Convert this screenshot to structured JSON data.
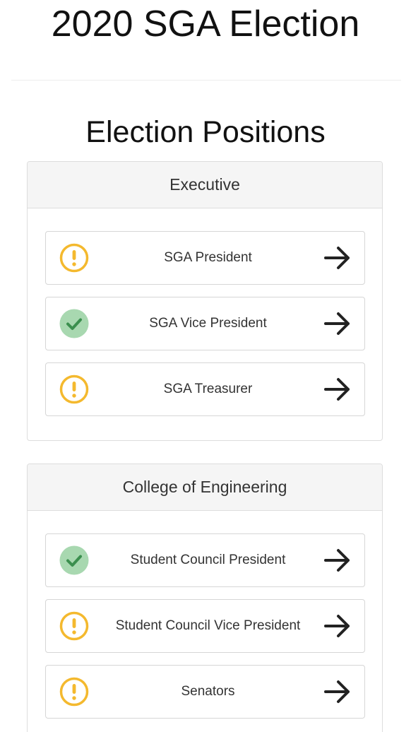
{
  "page": {
    "title": "2020 SGA Election",
    "section_heading": "Election Positions"
  },
  "colors": {
    "pending": "#f4b92e",
    "complete_bg": "#a8d8b0",
    "complete_check": "#3b8f4e"
  },
  "groups": [
    {
      "name": "Executive",
      "positions": [
        {
          "label": "SGA President",
          "status": "pending",
          "status_icon": "exclamation-circle-icon",
          "action_icon": "arrow-right-icon"
        },
        {
          "label": "SGA Vice President",
          "status": "complete",
          "status_icon": "check-circle-icon",
          "action_icon": "arrow-right-icon"
        },
        {
          "label": "SGA Treasurer",
          "status": "pending",
          "status_icon": "exclamation-circle-icon",
          "action_icon": "arrow-right-icon"
        }
      ]
    },
    {
      "name": "College of Engineering",
      "positions": [
        {
          "label": "Student Council President",
          "status": "complete",
          "status_icon": "check-circle-icon",
          "action_icon": "arrow-right-icon"
        },
        {
          "label": "Student Council Vice President",
          "status": "pending",
          "status_icon": "exclamation-circle-icon",
          "action_icon": "arrow-right-icon"
        },
        {
          "label": "Senators",
          "status": "pending",
          "status_icon": "exclamation-circle-icon",
          "action_icon": "arrow-right-icon"
        }
      ]
    }
  ]
}
